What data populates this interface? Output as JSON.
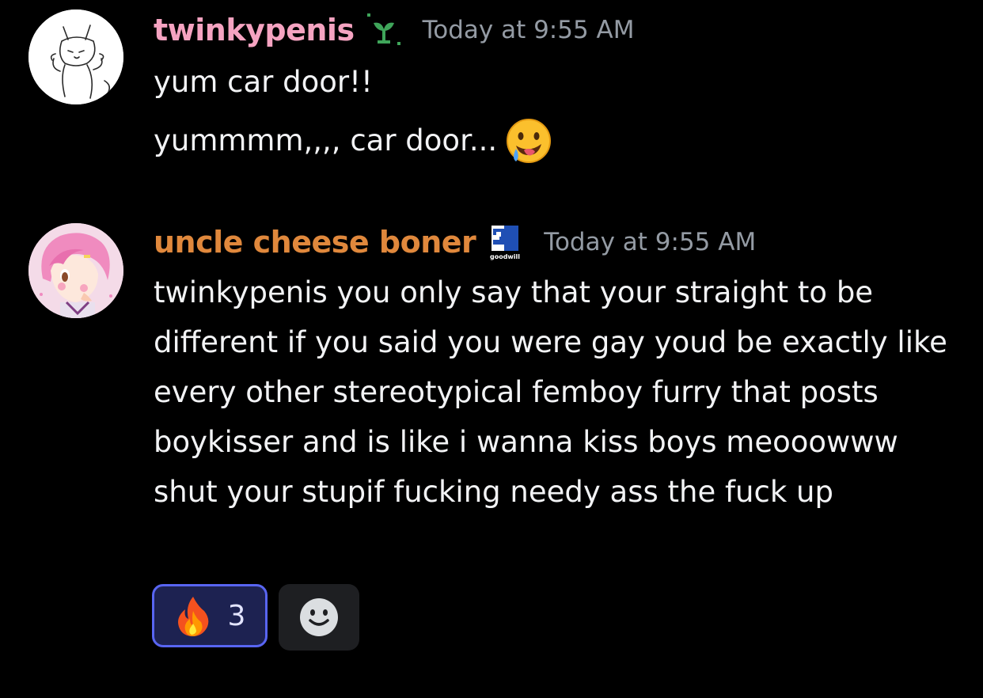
{
  "messages": [
    {
      "username": "twinkypenis",
      "username_color": "#f5a3c1",
      "badge_icon": "sprout-badge-icon",
      "timestamp": "Today at 9:55 AM",
      "lines": [
        "yum car door!!",
        "yummmm,,,, car door..."
      ],
      "trailing_emoji": "drooling-face-emoji"
    },
    {
      "username": "uncle cheese boner",
      "username_color": "#e0883c",
      "badge_icon": "goodwill-badge-icon",
      "badge_text": "goodwill",
      "timestamp": "Today at 9:55 AM",
      "text": "twinkypenis you only say that your straight to be different if you said you were gay youd be exactly like every other stereotypical femboy furry that posts boykisser and is like i wanna kiss boys meooowww shut your stupif fucking needy ass the fuck up",
      "reactions": [
        {
          "emoji": "fire-emoji",
          "count": "3",
          "active": true
        }
      ],
      "add_reaction_icon": "smiley-add-reaction-icon"
    }
  ],
  "colors": {
    "background": "#000000",
    "timestamp": "#949ba4",
    "message_text": "#f2f3f5",
    "reaction_border": "#5865f2",
    "reaction_bg": "#1d2251"
  }
}
